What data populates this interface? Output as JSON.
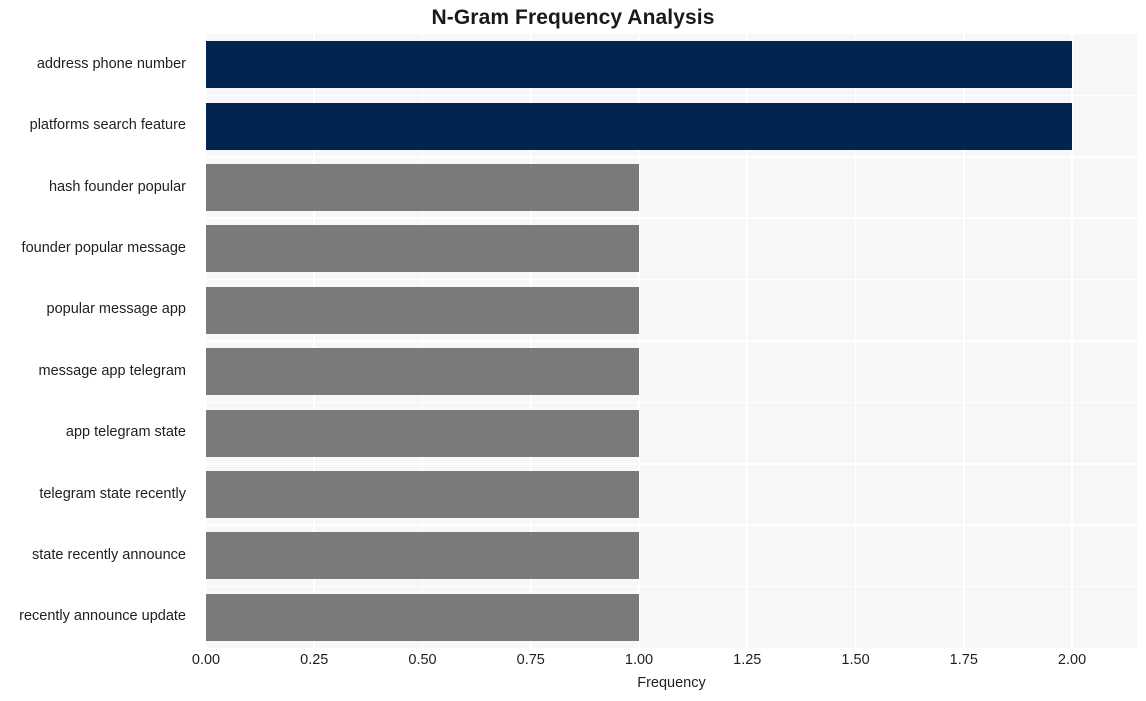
{
  "chart_data": {
    "type": "bar",
    "orientation": "horizontal",
    "title": "N-Gram Frequency Analysis",
    "xlabel": "Frequency",
    "ylabel": "",
    "categories": [
      "address phone number",
      "platforms search feature",
      "hash founder popular",
      "founder popular message",
      "popular message app",
      "message app telegram",
      "app telegram state",
      "telegram state recently",
      "state recently announce",
      "recently announce update"
    ],
    "values": [
      2,
      2,
      1,
      1,
      1,
      1,
      1,
      1,
      1,
      1
    ],
    "bar_colors": [
      "#012450",
      "#012450",
      "#7a7a78",
      "#7a7a78",
      "#7a7a78",
      "#7a7a78",
      "#7a7a78",
      "#7a7a78",
      "#7a7a78",
      "#7a7a78"
    ],
    "xlim": [
      0,
      2.15
    ],
    "xticks": [
      0,
      0.25,
      0.5,
      0.75,
      1,
      1.25,
      1.5,
      1.75,
      2
    ],
    "xtick_labels": [
      "0.00",
      "0.25",
      "0.50",
      "0.75",
      "1.00",
      "1.25",
      "1.50",
      "1.75",
      "2.00"
    ],
    "grid": true,
    "grid_color": "#ffffff",
    "plot_background": "#f7f6f8",
    "figure_background": "#ffffff",
    "legend": null,
    "highlight_color": "#012450",
    "default_color": "#7a7a78"
  }
}
